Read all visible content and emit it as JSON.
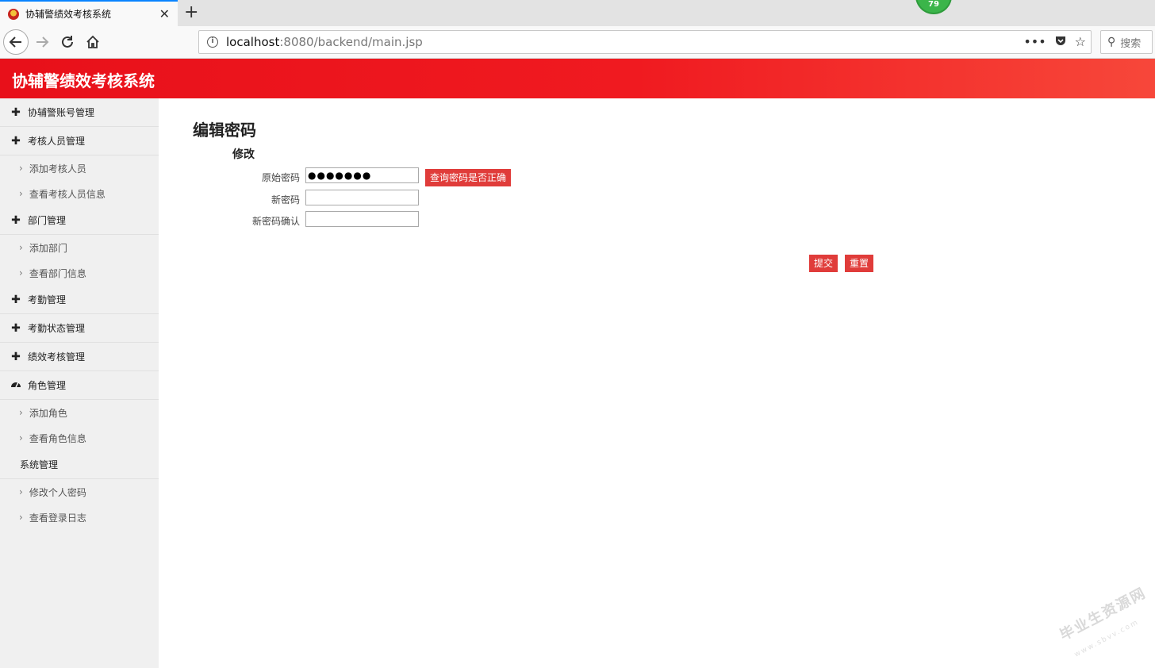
{
  "browser": {
    "tab_title": "协辅警绩效考核系统",
    "tab_close": "✕",
    "new_tab": "+",
    "badge": "79",
    "url_host": "localhost",
    "url_rest": ":8080/backend/main.jsp",
    "search_placeholder": "搜索",
    "icons": [
      "back-icon",
      "forward-icon",
      "reload-icon",
      "home-icon",
      "info-icon",
      "more-icon",
      "pocket-icon",
      "bookmark-star-icon",
      "search-icon"
    ]
  },
  "header": {
    "title": "协辅警绩效考核系统",
    "color_start": "#e8101a",
    "color_end": "#f7473a"
  },
  "sidebar": {
    "items": [
      {
        "label": "协辅警账号管理",
        "icon": "plus-icon"
      },
      {
        "label": "考核人员管理",
        "icon": "plus-icon"
      },
      {
        "label": "添加考核人员",
        "sub": true
      },
      {
        "label": "查看考核人员信息",
        "sub": true
      },
      {
        "label": "部门管理",
        "icon": "plus-icon"
      },
      {
        "label": "添加部门",
        "sub": true
      },
      {
        "label": "查看部门信息",
        "sub": true
      },
      {
        "label": "考勤管理",
        "icon": "plus-icon"
      },
      {
        "label": "考勤状态管理",
        "icon": "plus-icon"
      },
      {
        "label": "绩效考核管理",
        "icon": "plus-icon"
      },
      {
        "label": "角色管理",
        "icon": "dashboard-icon"
      },
      {
        "label": "添加角色",
        "sub": true
      },
      {
        "label": "查看角色信息",
        "sub": true
      },
      {
        "label": "系统管理"
      },
      {
        "label": "修改个人密码",
        "sub": true
      },
      {
        "label": "查看登录日志",
        "sub": true
      }
    ]
  },
  "main": {
    "page_title": "编辑密码",
    "section_title": "修改",
    "fields": {
      "old_password_label": "原始密码",
      "old_password_value": "●●●●●●●",
      "new_password_label": "新密码",
      "new_password_value": "",
      "confirm_label": "新密码确认",
      "confirm_value": ""
    },
    "check_button": "查询密码是否正确",
    "submit_button": "提交",
    "reset_button": "重置",
    "accent_color": "#e03c3a"
  },
  "watermark": {
    "text": "毕业生资源网",
    "sub": "www.sbvv.com"
  }
}
